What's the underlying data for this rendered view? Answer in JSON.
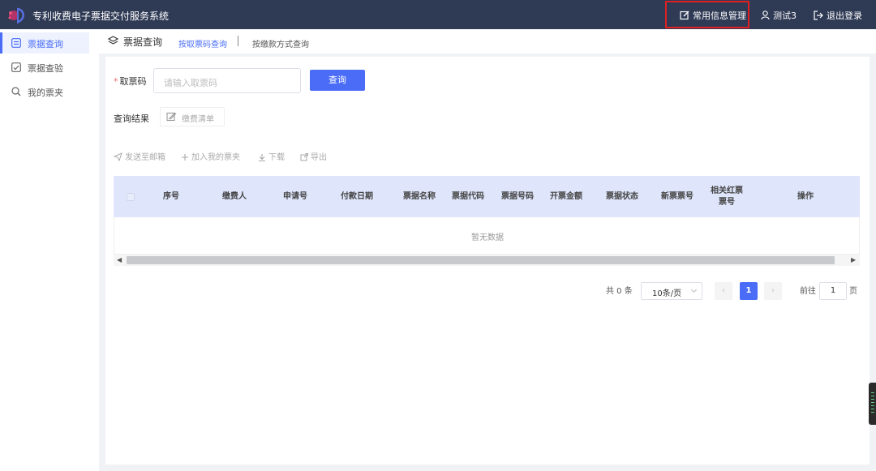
{
  "header": {
    "app_title": "专利收费电子票据交付服务系统",
    "info_manage_label": "常用信息管理",
    "user_label": "测试3",
    "logout_label": "退出登录"
  },
  "sidebar": {
    "items": [
      {
        "label": "票据查询",
        "icon": "receipt-icon",
        "active": true
      },
      {
        "label": "票据查验",
        "icon": "check-icon",
        "active": false
      },
      {
        "label": "我的票夹",
        "icon": "search-icon",
        "active": false
      }
    ]
  },
  "page": {
    "title": "票据查询",
    "tabs": [
      {
        "label": "按取票码查询",
        "active": true
      },
      {
        "label": "按缴款方式查询",
        "active": false
      }
    ]
  },
  "query": {
    "code_label": "取票码",
    "code_placeholder": "请输入取票码",
    "code_value": "",
    "query_button": "查询"
  },
  "result": {
    "label": "查询结果",
    "fee_list_button": "缴费清单"
  },
  "actions": [
    {
      "label": "发送至邮箱",
      "icon": "send-icon"
    },
    {
      "label": "加入我的票夹",
      "icon": "plus-icon"
    },
    {
      "label": "下载",
      "icon": "download-icon"
    },
    {
      "label": "导出",
      "icon": "export-icon"
    }
  ],
  "table": {
    "columns": [
      "",
      "序号",
      "缴费人",
      "申请号",
      "付款日期",
      "票据名称",
      "票据代码",
      "票据号码",
      "开票金额",
      "票据状态",
      "新票票号",
      "相关红票\n票号",
      "操作"
    ],
    "rows": [],
    "empty_text": "暂无数据"
  },
  "pagination": {
    "total_label": "共 0 条",
    "page_size": "10条/页",
    "current_page": "1",
    "goto_label": "前往",
    "goto_value": "1",
    "page_suffix": "页"
  },
  "colors": {
    "topbar": "#2f3a55",
    "accent": "#4a6cf7",
    "highlight": "#e02020"
  }
}
